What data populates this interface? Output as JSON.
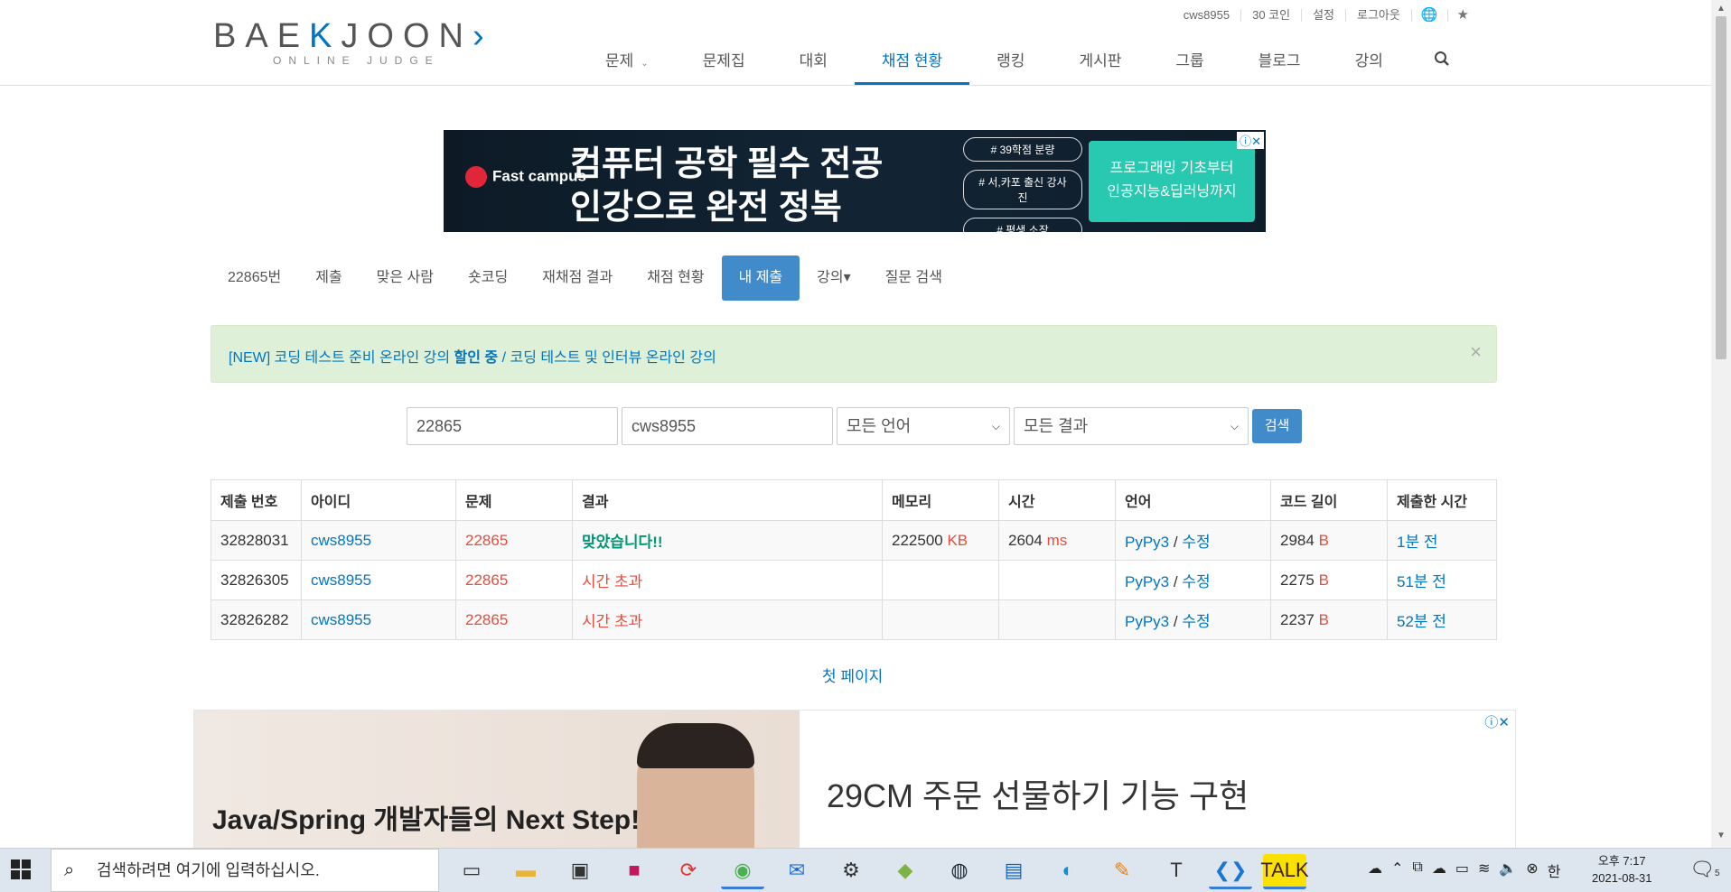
{
  "logo": {
    "main_a": "BAE",
    "main_k": "K",
    "main_b": "JOON",
    "sub": "ONLINE JUDGE"
  },
  "topbar": {
    "user": "cws8955",
    "coins": "30 코인",
    "settings": "설정",
    "logout": "로그아웃"
  },
  "mainnav": {
    "problems": "문제",
    "workbook": "문제집",
    "contest": "대회",
    "status": "채점 현황",
    "ranking": "랭킹",
    "board": "게시판",
    "group": "그룹",
    "blog": "블로그",
    "lecture": "강의"
  },
  "ad_top": {
    "brand": "Fast campus",
    "headline1": "컴퓨터 공학 필수 전공",
    "headline2": "인강으로 완전 정복",
    "tags": [
      "# 39학점 분량",
      "# 서,카포 출신 강사진",
      "# 평생 소장"
    ],
    "cta1": "프로그래밍 기초부터",
    "cta2": "인공지능&딥러닝까지"
  },
  "subnav": [
    "22865번",
    "제출",
    "맞은 사람",
    "숏코딩",
    "재채점 결과",
    "채점 현황",
    "내 제출",
    "강의▾",
    "질문 검색"
  ],
  "alert": {
    "prefix": "[NEW] 코딩 테스트 준비 온라인 강의 ",
    "bold": "할인 중",
    "suffix": " / 코딩 테스트 및 인터뷰 온라인 강의"
  },
  "filters": {
    "problem": "22865",
    "user": "cws8955",
    "language": "모든 언어",
    "result": "모든 결과",
    "search": "검색"
  },
  "table": {
    "headers": [
      "제출 번호",
      "아이디",
      "문제",
      "결과",
      "메모리",
      "시간",
      "언어",
      "코드 길이",
      "제출한 시간"
    ],
    "rows": [
      {
        "id": "32828031",
        "user": "cws8955",
        "problem": "22865",
        "result": "맞았습니다!!",
        "memory": "222500",
        "memory_unit": "KB",
        "time": "2604",
        "time_unit": "ms",
        "lang": "PyPy3",
        "edit": "수정",
        "length": "2984",
        "length_unit": "B",
        "submitted": "1분 전"
      },
      {
        "id": "32826305",
        "user": "cws8955",
        "problem": "22865",
        "result": "시간 초과",
        "memory": "",
        "memory_unit": "",
        "time": "",
        "time_unit": "",
        "lang": "PyPy3",
        "edit": "수정",
        "length": "2275",
        "length_unit": "B",
        "submitted": "51분 전"
      },
      {
        "id": "32826282",
        "user": "cws8955",
        "problem": "22865",
        "result": "시간 초과",
        "memory": "",
        "memory_unit": "",
        "time": "",
        "time_unit": "",
        "lang": "PyPy3",
        "edit": "수정",
        "length": "2237",
        "length_unit": "B",
        "submitted": "52분 전"
      }
    ]
  },
  "first_page": "첫 페이지",
  "ad_bottom": {
    "left_text": "Java/Spring 개발자들의 Next Step!",
    "title": "29CM 주문 선물하기 기능 구현"
  },
  "taskbar": {
    "search_placeholder": "검색하려면 여기에 입력하십시오.",
    "ime": "한",
    "time": "오후 7:17",
    "date": "2021-08-31",
    "notif_count": "5"
  }
}
